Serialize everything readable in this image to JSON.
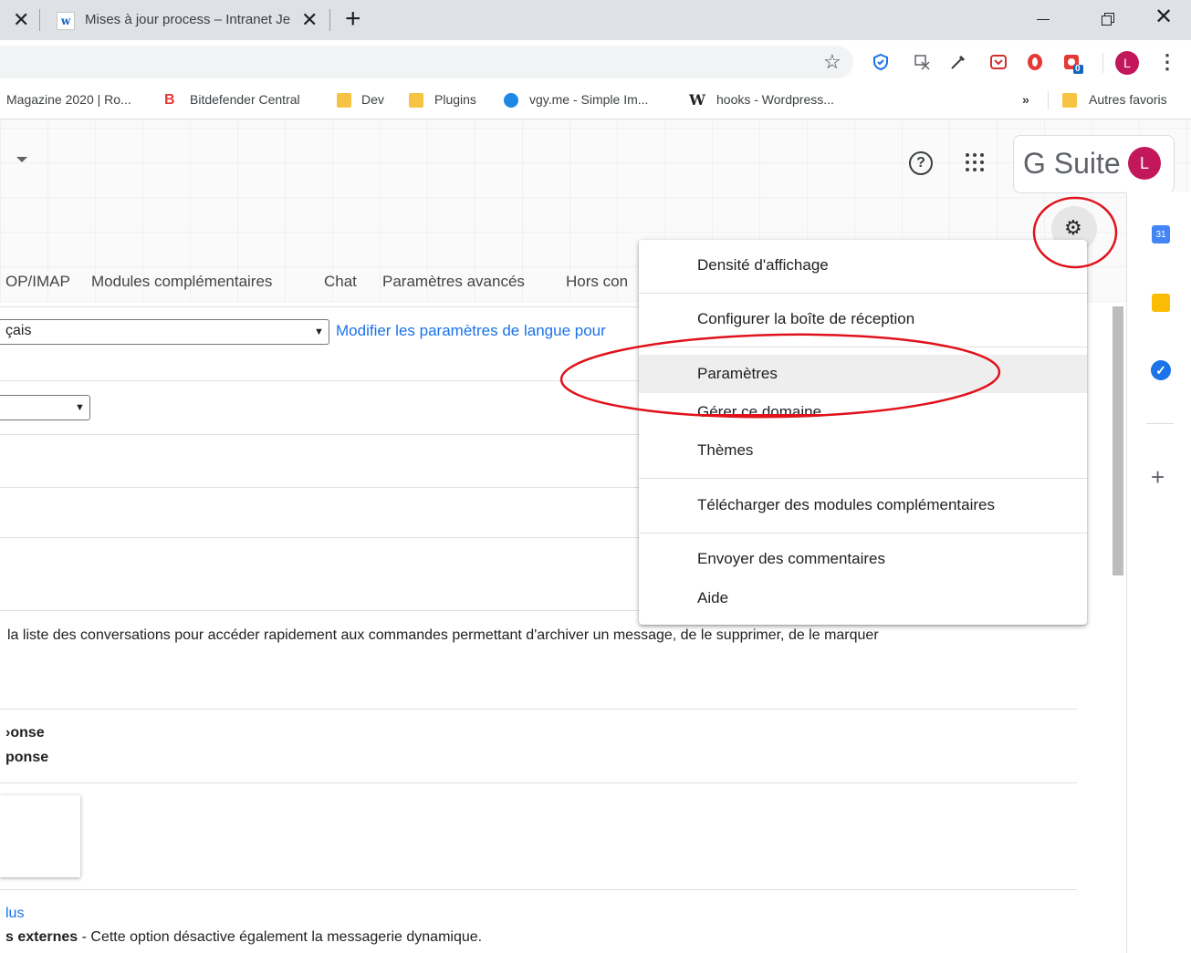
{
  "browser": {
    "prev_tab_close": "✕",
    "active_tab": {
      "favicon": "w",
      "title": "Mises à jour process – Intranet Je",
      "close": "✕"
    },
    "new_tab": "+",
    "window_controls": {
      "close": "✕"
    }
  },
  "toolbar": {
    "star": "☆",
    "menu": "⋮",
    "profile_initial": "L",
    "extensions": [
      {
        "icon": "shield-check-icon",
        "glyph": "⛨",
        "color": "#1a73e8"
      },
      {
        "icon": "translate-icon",
        "glyph": "⧉",
        "color": "#5f6368"
      },
      {
        "icon": "eyedropper-icon",
        "glyph": "✎",
        "color": "#3c4043"
      },
      {
        "icon": "pocket-icon",
        "glyph": "◫",
        "color": "#d32f2f"
      },
      {
        "icon": "opera-icon",
        "glyph": "●",
        "color": "#e53935"
      },
      {
        "icon": "badge-icon",
        "glyph": "✱",
        "color": "#e53935",
        "badge": "0"
      }
    ]
  },
  "bookmarks": {
    "items": [
      {
        "label": "Magazine 2020 | Ro..."
      },
      {
        "icon_text": "B",
        "label": "Bitdefender Central"
      },
      {
        "label": "Dev"
      },
      {
        "label": "Plugins"
      },
      {
        "label": "vgy.me - Simple Im..."
      },
      {
        "icon_text": "W",
        "label": "hooks - Wordpress..."
      }
    ],
    "overflow": "»",
    "other": "Autres favoris"
  },
  "gmail_header": {
    "help": "?",
    "brand": "G Suite",
    "avatar_initial": "L",
    "gear": "⚙"
  },
  "side_panel": {
    "calendar_day": "31",
    "tasks_glyph": "✓",
    "add": "+"
  },
  "settings_tabs": [
    "OP/IMAP",
    "Modules complémentaires",
    "Chat",
    "Paramètres avancés",
    "Hors con"
  ],
  "settings": {
    "language_value": "çais",
    "language_link": "Modifier les paramètres de langue pour",
    "select_arrow": "▼",
    "hover_actions_text": "la liste des conversations pour accéder rapidement aux commandes permettant d'archiver un message, de le supprimer, de le marquer",
    "reply_line1": "›onse",
    "reply_line2": "ponse",
    "more_link": "lus",
    "external_bold": "s externes",
    "external_rest": " - Cette option désactive également la messagerie dynamique."
  },
  "menu": {
    "items": [
      "Densité d'affichage",
      "Configurer la boîte de réception",
      "Paramètres",
      "Gérer ce domaine",
      "Thèmes",
      "Télécharger des modules complémentaires",
      "Envoyer des commentaires",
      "Aide"
    ]
  },
  "annotation_color": "#e0121c"
}
